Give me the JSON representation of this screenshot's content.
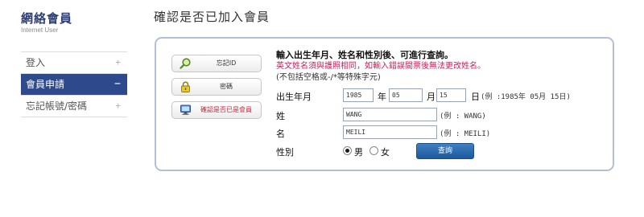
{
  "sidebar": {
    "title": "網絡會員",
    "subtitle": "Internet User",
    "items": [
      {
        "label": "登入",
        "sign": "+"
      },
      {
        "label": "會員申請",
        "sign": "−"
      },
      {
        "label": "忘記帳號/密碼",
        "sign": "+"
      }
    ]
  },
  "page": {
    "title": "確認是否已加入會員"
  },
  "side_buttons": [
    {
      "label": "忘記ID",
      "icon": "magnifier-icon"
    },
    {
      "label": "密碼",
      "icon": "lock-icon"
    },
    {
      "label": "確認是否已是會員",
      "icon": "computer-icon"
    }
  ],
  "form": {
    "heading": "輸入出生年月、姓名和性別後、可進行查詢。",
    "warning": "英文姓名須與護照相同，如輸入錯誤間票後無法更改姓名。",
    "note": "(不包括空格或-/*等特殊字元)",
    "birth": {
      "label": "出生年月",
      "year_value": "1985",
      "year_unit": "年",
      "month_value": "05",
      "month_unit": "月",
      "day_value": "15",
      "day_unit": "日",
      "example": "(例 :1985年 05月 15日)"
    },
    "surname": {
      "label": "姓",
      "value": "WANG",
      "example": "(例 : WANG)"
    },
    "given_name": {
      "label": "名",
      "value": "MEILI",
      "example": "(例 : MEILI)"
    },
    "gender": {
      "label": "性別",
      "options": [
        {
          "label": "男",
          "selected": true
        },
        {
          "label": "女",
          "selected": false
        }
      ]
    },
    "submit_label": "查詢"
  },
  "colors": {
    "accent": "#2f4a8c",
    "panel_border": "#b3bfd9",
    "warning": "#cc1f5a",
    "button": "#1c5a9c"
  }
}
